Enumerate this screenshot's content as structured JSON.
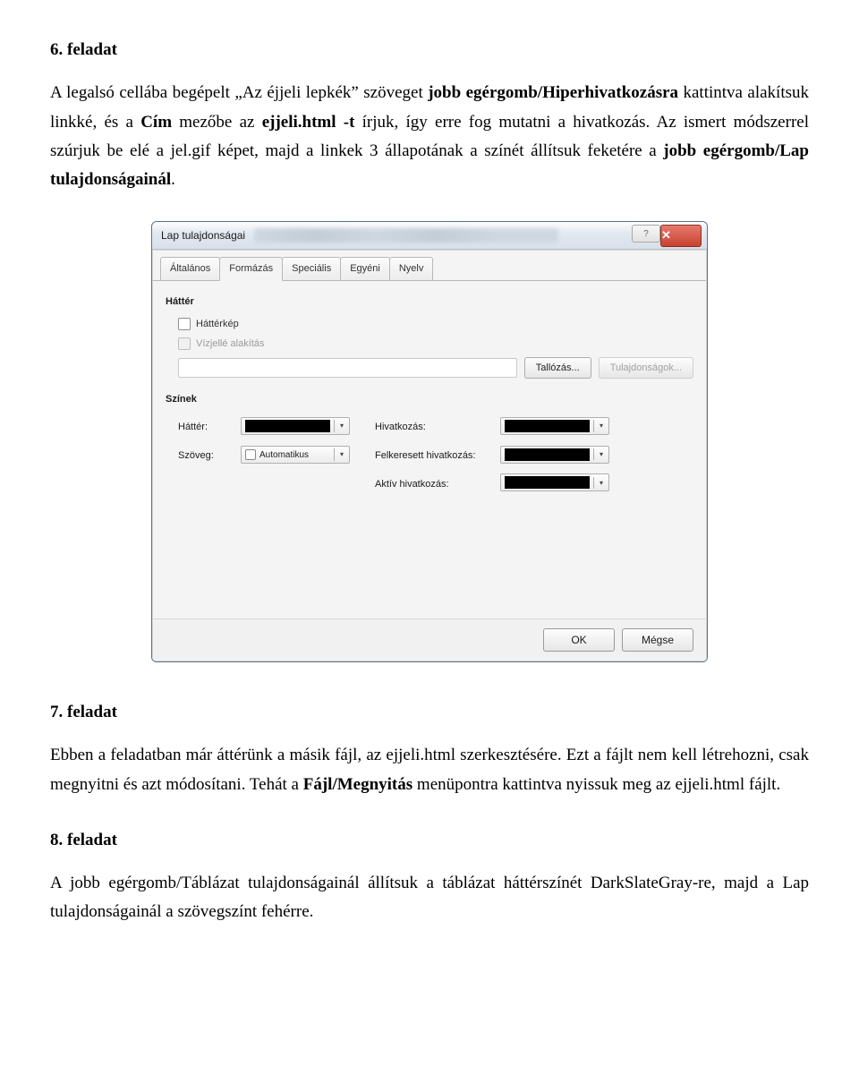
{
  "task6": {
    "heading": "6. feladat",
    "p1_a": "A legalsó cellába begépelt „Az éjjeli lepkék” szöveget ",
    "p1_b": "jobb egérgomb/Hiperhivatkozásra",
    "p1_c": " kattintva alakítsuk linkké, és a ",
    "p1_d": "Cím",
    "p1_e": " mezőbe az ",
    "p1_f": "ejjeli.html -t",
    "p1_g": " írjuk, így erre fog mutatni a hivatkozás. Az ismert módszerrel szúrjuk be elé a jel.gif képet, majd a linkek 3 állapotának a színét állítsuk feketére a ",
    "p1_h": "jobb egérgomb/Lap tulajdonságainál",
    "p1_i": "."
  },
  "dialog": {
    "title": "Lap tulajdonságai",
    "help_icon": "?",
    "close_icon": "✕",
    "tabs": [
      "Általános",
      "Formázás",
      "Speciális",
      "Egyéni",
      "Nyelv"
    ],
    "selected_tab": "Formázás",
    "bg_group": "Háttér",
    "bg_image": "Háttérkép",
    "bg_watermark": "Vízjellé alakítás",
    "browse": "Tallózás...",
    "properties": "Tulajdonságok...",
    "colors_group": "Színek",
    "lbl_bg": "Háttér:",
    "lbl_text": "Szöveg:",
    "auto": "Automatikus",
    "lbl_link": "Hivatkozás:",
    "lbl_visited": "Felkeresett hivatkozás:",
    "lbl_active": "Aktív hivatkozás:",
    "ok": "OK",
    "cancel": "Mégse"
  },
  "task7": {
    "heading": "7. feladat",
    "p1_a": "Ebben a feladatban már áttérünk a másik fájl, az ejjeli.html szerkesztésére. Ezt a fájlt nem kell létrehozni, csak megnyitni és azt módosítani. Tehát a ",
    "p1_b": "Fájl/Megnyitás",
    "p1_c": " menüpontra kattintva nyissuk meg az ejjeli.html fájlt."
  },
  "task8": {
    "heading": "8. feladat",
    "p1": "A jobb egérgomb/Táblázat tulajdonságainál állítsuk a táblázat háttérszínét DarkSlateGray-re, majd a Lap tulajdonságainál a szövegszínt fehérre."
  }
}
